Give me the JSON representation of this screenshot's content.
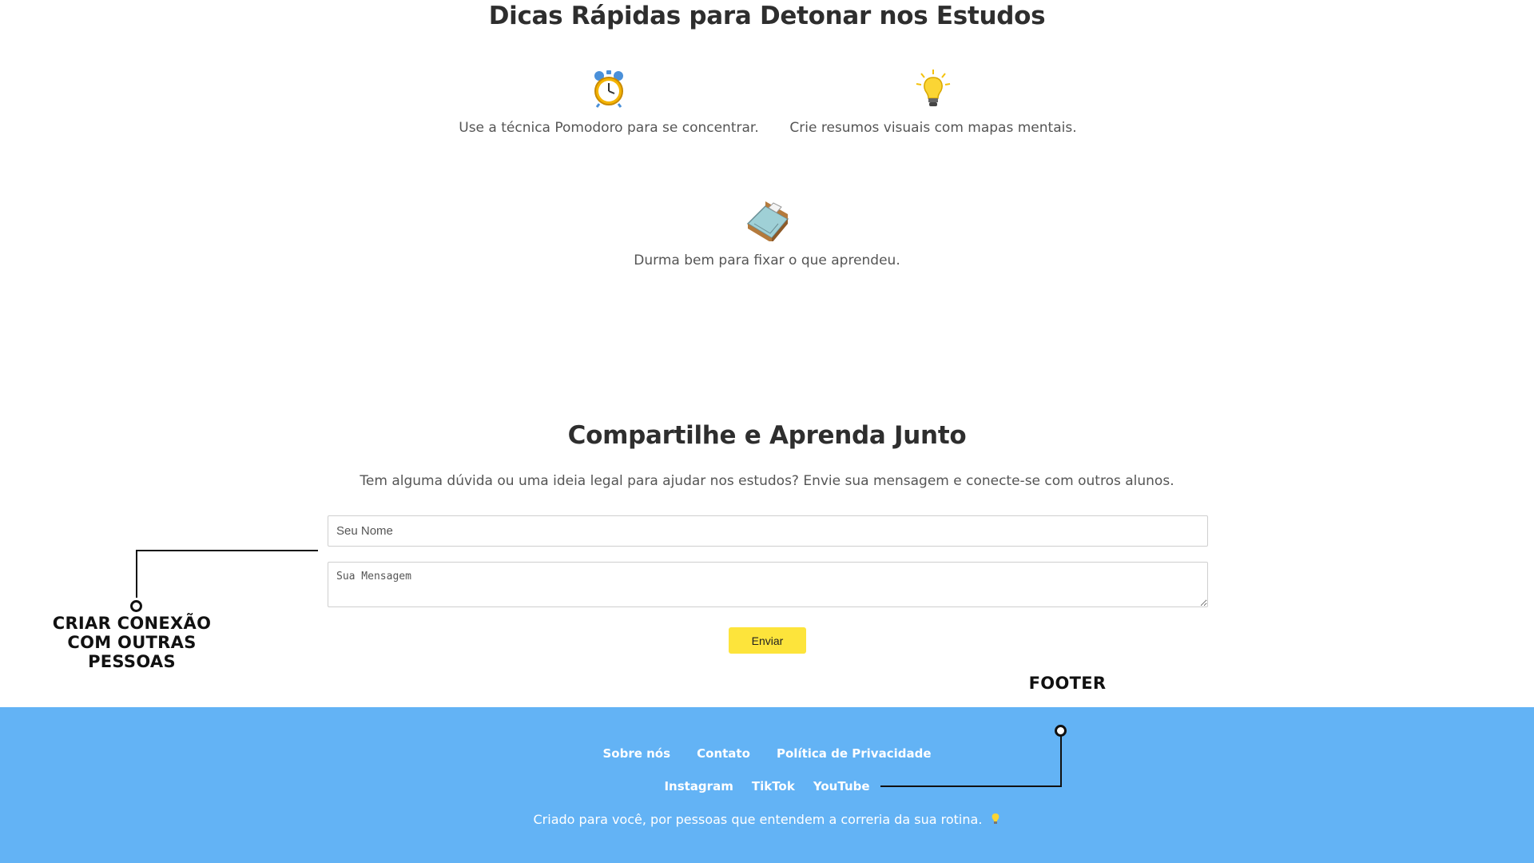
{
  "tips": {
    "title": "Dicas Rápidas para Detonar nos Estudos",
    "items": [
      {
        "icon": "alarm-clock-icon",
        "text": "Use a técnica Pomodoro para se concentrar."
      },
      {
        "icon": "lightbulb-icon",
        "text": "Crie resumos visuais com mapas mentais."
      },
      {
        "icon": "bed-icon",
        "text": "Durma bem para fixar o que aprendeu."
      }
    ]
  },
  "share": {
    "title": "Compartilhe e Aprenda Junto",
    "description": "Tem alguma dúvida ou uma ideia legal para ajudar nos estudos? Envie sua mensagem e conecte-se com outros alunos.",
    "name_placeholder": "Seu Nome",
    "message_placeholder": "Sua Mensagem",
    "send_label": "Enviar",
    "button_color": "#fde43b"
  },
  "annotations": {
    "conexao_line1": "CRIAR CONEXÃO",
    "conexao_line2": "COM OUTRAS PESSOAS",
    "footer_label": "FOOTER"
  },
  "footer": {
    "background_color": "#63b3f5",
    "nav": [
      "Sobre nós",
      "Contato",
      "Política de Privacidade"
    ],
    "social": [
      "Instagram",
      "TikTok",
      "YouTube"
    ],
    "credit": "Criado para você, por pessoas que entendem a correria da sua rotina.",
    "credit_icon": "lightbulb-icon"
  }
}
